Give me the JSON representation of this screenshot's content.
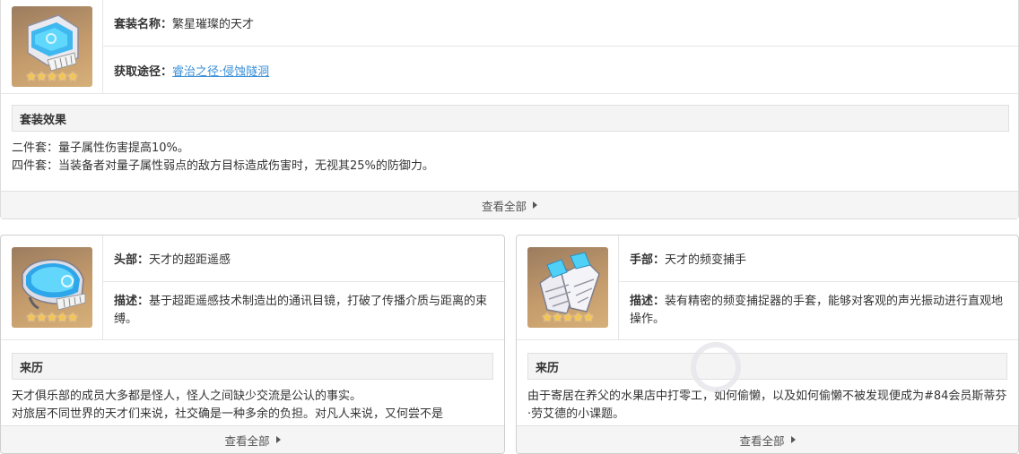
{
  "set": {
    "name_label": "套装名称：",
    "name_value": "繁星璀璨的天才",
    "source_label": "获取途径：",
    "source_link": "睿治之径·侵蚀隧洞",
    "stars": "★★★★★",
    "effect_header": "套装效果",
    "effect_lines": [
      "二件套：量子属性伤害提高10%。",
      "四件套：当装备者对量子属性弱点的敌方目标造成伤害时，无视其25%的防御力。"
    ],
    "view_all": "查看全部"
  },
  "pieces": [
    {
      "slot_label": "头部：",
      "slot_value": "天才的超距遥感",
      "desc_label": "描述：",
      "desc_value": "基于超距遥感技术制造出的通讯目镜，打破了传播介质与距离的束缚。",
      "stars": "★★★★★",
      "lore_header": "来历",
      "lore_lines": [
        "天才俱乐部的成员大多都是怪人，怪人之间缺少交流是公认的事实。",
        "对旅居不同世界的天才们来说，社交确是一种多余的负担。对凡人来说，又何尝不是"
      ],
      "view_all": "查看全部"
    },
    {
      "slot_label": "手部：",
      "slot_value": "天才的频变捕手",
      "desc_label": "描述：",
      "desc_value": "装有精密的频变捕捉器的手套，能够对客观的声光振动进行直观地操作。",
      "stars": "★★★★★",
      "lore_header": "来历",
      "lore_lines": [
        "由于寄居在养父的水果店中打零工，如何偷懒，以及如何偷懒不被发现便成为#84会员斯蒂芬·劳艾德的小课题。"
      ],
      "view_all": "查看全部"
    }
  ]
}
